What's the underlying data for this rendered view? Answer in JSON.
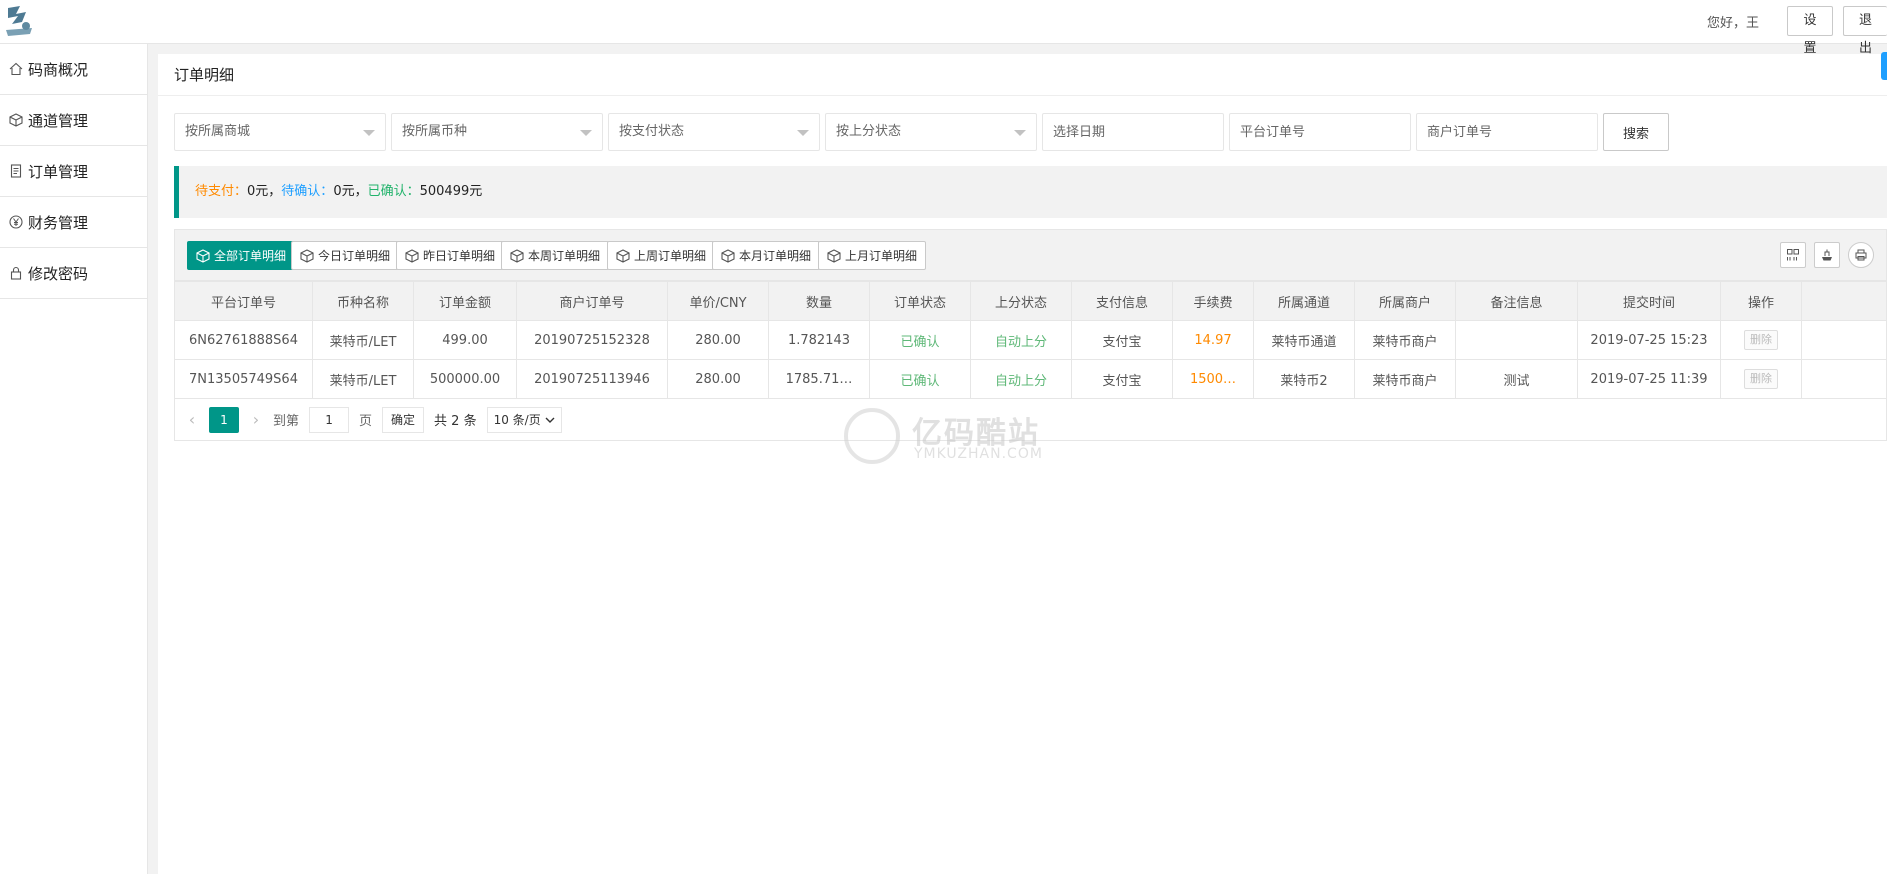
{
  "header": {
    "greeting": "您好，王",
    "settings_label": "设置",
    "logout_label": "退出"
  },
  "sidebar": {
    "items": [
      {
        "label": "码商概况",
        "icon": "home-icon"
      },
      {
        "label": "通道管理",
        "icon": "cube-icon"
      },
      {
        "label": "订单管理",
        "icon": "file-icon"
      },
      {
        "label": "财务管理",
        "icon": "yen-icon"
      },
      {
        "label": "修改密码",
        "icon": "lock-icon"
      }
    ]
  },
  "page": {
    "title": "订单明细"
  },
  "filters": {
    "mall_placeholder": "按所属商城",
    "currency_placeholder": "按所属币种",
    "pay_status_placeholder": "按支付状态",
    "upscore_placeholder": "按上分状态",
    "date_placeholder": "选择日期",
    "platform_order_placeholder": "平台订单号",
    "merchant_order_placeholder": "商户订单号",
    "search_label": "搜索"
  },
  "summary": {
    "pending_pay_label": "待支付：",
    "pending_pay_value": "0元，",
    "pending_confirm_label": "待确认：",
    "pending_confirm_value": "0元，",
    "confirmed_label": "已确认：",
    "confirmed_value": "500499元"
  },
  "toolbar": {
    "buttons": [
      {
        "label": "全部订单明细",
        "active": true
      },
      {
        "label": "今日订单明细"
      },
      {
        "label": "昨日订单明细"
      },
      {
        "label": "本周订单明细"
      },
      {
        "label": "上周订单明细"
      },
      {
        "label": "本月订单明细"
      },
      {
        "label": "上月订单明细"
      }
    ],
    "tools": [
      "columns-icon",
      "export-icon",
      "print-icon"
    ]
  },
  "table": {
    "columns": [
      "平台订单号",
      "币种名称",
      "订单金额",
      "商户订单号",
      "单价/CNY",
      "数量",
      "订单状态",
      "上分状态",
      "支付信息",
      "手续费",
      "所属通道",
      "所属商户",
      "备注信息",
      "提交时间",
      "操作"
    ],
    "rows": [
      [
        "6N62761888S64",
        "莱特币/LET",
        "499.00",
        "20190725152328",
        "280.00",
        "1.782143",
        "已确认",
        "自动上分",
        "支付宝",
        "14.97",
        "莱特币通道",
        "莱特币商户",
        "",
        "2019-07-25 15:23",
        "删除"
      ],
      [
        "7N13505749S64",
        "莱特币/LET",
        "500000.00",
        "20190725113946",
        "280.00",
        "1785.71…",
        "已确认",
        "自动上分",
        "支付宝",
        "1500…",
        "莱特币2",
        "莱特币商户",
        "测试",
        "2019-07-25 11:39",
        "删除"
      ]
    ]
  },
  "pager": {
    "current_page": "1",
    "goto_label": "到第",
    "goto_value": "1",
    "page_label": "页",
    "confirm_label": "确定",
    "total_label": "共 2 条",
    "page_size_label": "10 条/页"
  },
  "watermark": {
    "title": "亿码酷站",
    "subtitle": "YMKUZHAN.COM"
  }
}
